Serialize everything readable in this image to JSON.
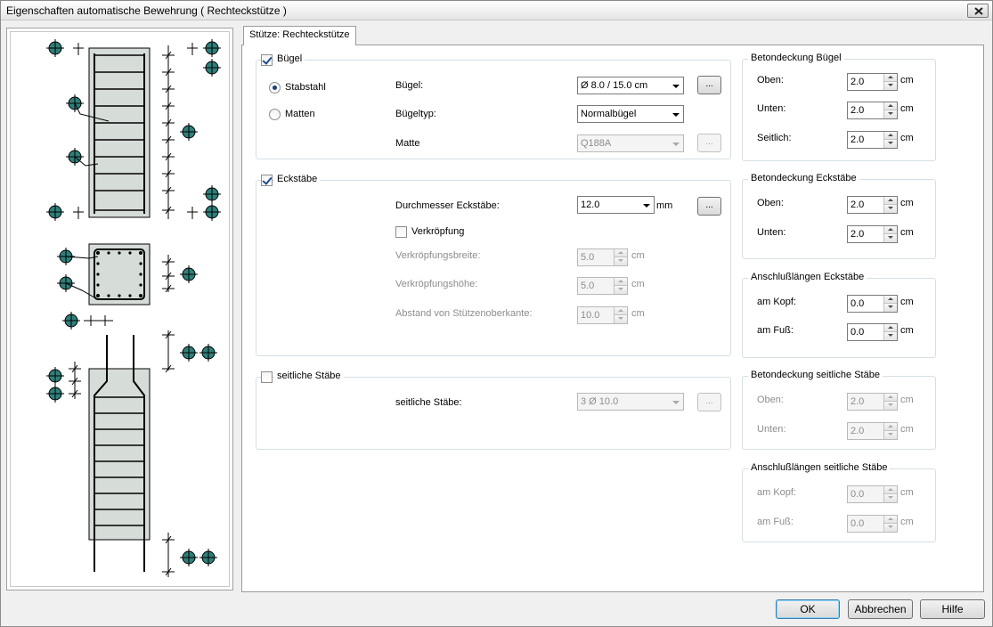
{
  "window": {
    "title": "Eigenschaften automatische Bewehrung ( Rechteckstütze )"
  },
  "tab": {
    "label": "Stütze: Rechteckstütze"
  },
  "buegel_group": {
    "title": "Bügel",
    "checked": true,
    "radio_stabstahl": "Stabstahl",
    "radio_matten": "Matten",
    "buegel_label": "Bügel:",
    "buegel_value": "Ø 8.0 / 15.0 cm",
    "buegeltyp_label": "Bügeltyp:",
    "buegeltyp_value": "Normalbügel",
    "matte_label": "Matte",
    "matte_value": "Q188A",
    "dots": "..."
  },
  "eckstaebe_group": {
    "title": "Eckstäbe",
    "checked": true,
    "durchmesser_label": "Durchmesser Eckstäbe:",
    "durchmesser_value": "12.0",
    "durchmesser_unit": "mm",
    "verkroepfung_label": "Verkröpfung",
    "breite_label": "Verkröpfungsbreite:",
    "breite_value": "5.0",
    "hoehe_label": "Verkröpfungshöhe:",
    "hoehe_value": "5.0",
    "abstand_label": "Abstand von Stützenoberkante:",
    "abstand_value": "10.0",
    "unit_cm": "cm",
    "dots": "..."
  },
  "seitliche_group": {
    "title": "seitliche Stäbe",
    "label": "seitliche Stäbe:",
    "value": "3 Ø 10.0",
    "dots": "..."
  },
  "betondeckung_buegel": {
    "title": "Betondeckung Bügel",
    "oben_label": "Oben:",
    "oben_value": "2.0",
    "unten_label": "Unten:",
    "unten_value": "2.0",
    "seitlich_label": "Seitlich:",
    "seitlich_value": "2.0",
    "unit": "cm"
  },
  "betondeckung_eck": {
    "title": "Betondeckung Eckstäbe",
    "oben_label": "Oben:",
    "oben_value": "2.0",
    "unten_label": "Unten:",
    "unten_value": "2.0",
    "unit": "cm"
  },
  "anschluss_eck": {
    "title": "Anschlußlängen Eckstäbe",
    "kopf_label": "am Kopf:",
    "kopf_value": "0.0",
    "fuss_label": "am Fuß:",
    "fuss_value": "0.0",
    "unit": "cm"
  },
  "betondeckung_seitlich": {
    "title": "Betondeckung seitliche Stäbe",
    "oben_label": "Oben:",
    "oben_value": "2.0",
    "unten_label": "Unten:",
    "unten_value": "2.0",
    "unit": "cm"
  },
  "anschluss_seitlich": {
    "title": "Anschlußlängen seitliche Stäbe",
    "kopf_label": "am Kopf:",
    "kopf_value": "0.0",
    "fuss_label": "am Fuß:",
    "fuss_value": "0.0",
    "unit": "cm"
  },
  "buttons": {
    "ok": "OK",
    "cancel": "Abbrechen",
    "help": "Hilfe"
  },
  "colors": {
    "column_fill": "#d6ddd8",
    "marker_fill": "#2f7f7a",
    "accent": "#3c7fb1"
  }
}
